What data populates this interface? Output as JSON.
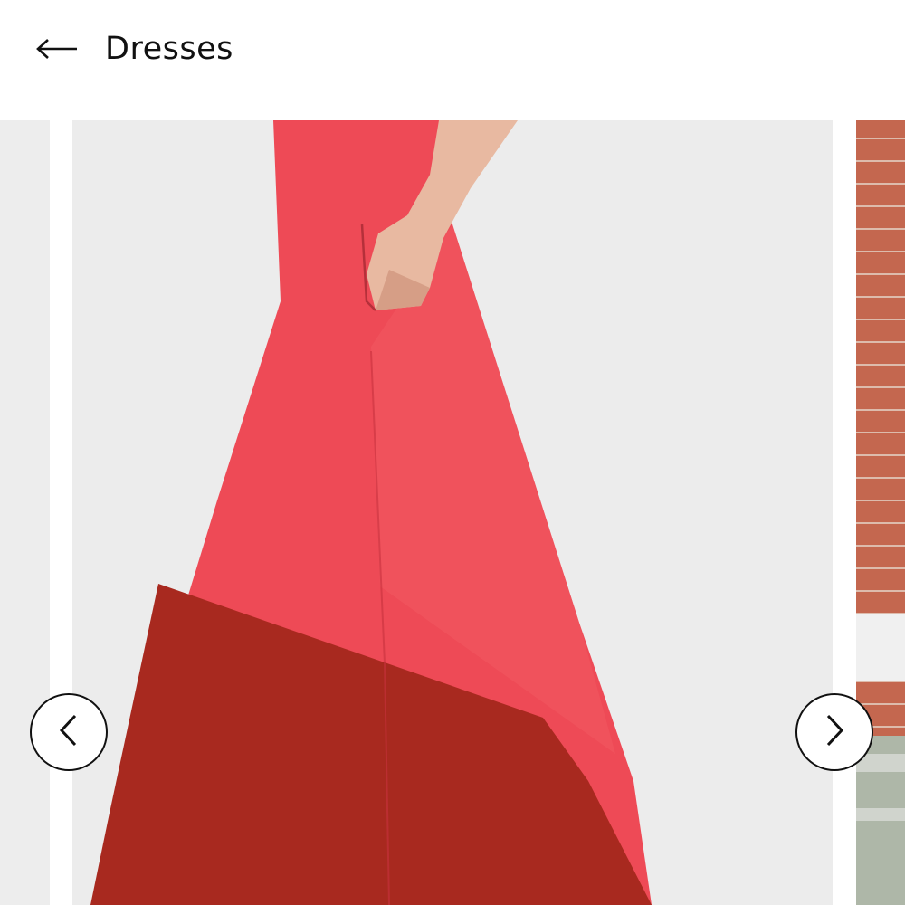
{
  "header": {
    "back_icon": "arrow-left-icon",
    "title": "Dresses"
  },
  "carousel": {
    "prev_icon": "chevron-left-icon",
    "next_icon": "chevron-right-icon",
    "slides": [
      {
        "role": "previous-peek",
        "background": "#ededed"
      },
      {
        "role": "current",
        "background": "#ececec",
        "dress_top_color": "#ee4a56",
        "dress_band_color": "#a8291f"
      },
      {
        "role": "next-peek",
        "background": "#c4674f"
      }
    ]
  }
}
